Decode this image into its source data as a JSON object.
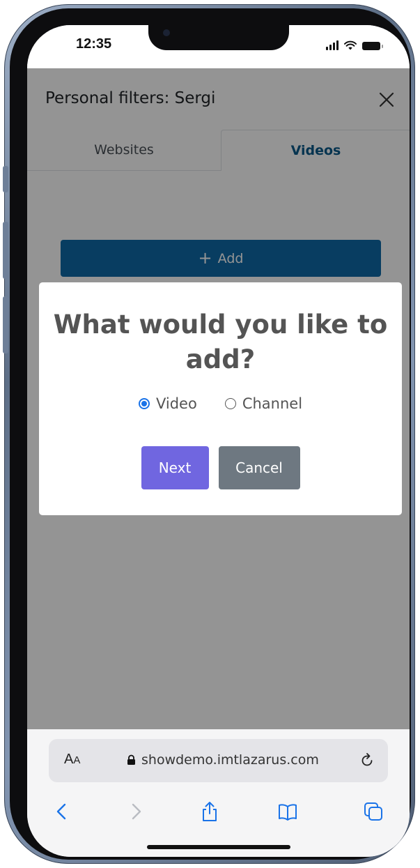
{
  "status_bar": {
    "time": "12:35"
  },
  "page": {
    "title": "Personal filters: Sergi",
    "tabs": [
      {
        "label": "Websites",
        "active": false
      },
      {
        "label": "Videos",
        "active": true
      }
    ],
    "add_button_label": "Add"
  },
  "modal": {
    "title": "What would you like to add?",
    "options": [
      {
        "label": "Video",
        "checked": true
      },
      {
        "label": "Channel",
        "checked": false
      }
    ],
    "next_label": "Next",
    "cancel_label": "Cancel"
  },
  "browser": {
    "text_size_label_large": "A",
    "text_size_label_small": "A",
    "url": "showdemo.imtlazarus.com"
  },
  "colors": {
    "primary": "#0e6aa8",
    "next_button": "#7066e0",
    "cancel_button": "#6e7881",
    "active_tab": "#0b5a8a",
    "radio_accent": "#1a73e8",
    "safari_blue": "#1a73e8"
  },
  "icons": {
    "close": "close-icon",
    "add": "plus-icon",
    "lock": "lock-icon",
    "reload": "reload-icon",
    "back": "chevron-left-icon",
    "forward": "chevron-right-icon",
    "share": "share-icon",
    "bookmarks": "book-icon",
    "tabs": "tabs-icon"
  }
}
